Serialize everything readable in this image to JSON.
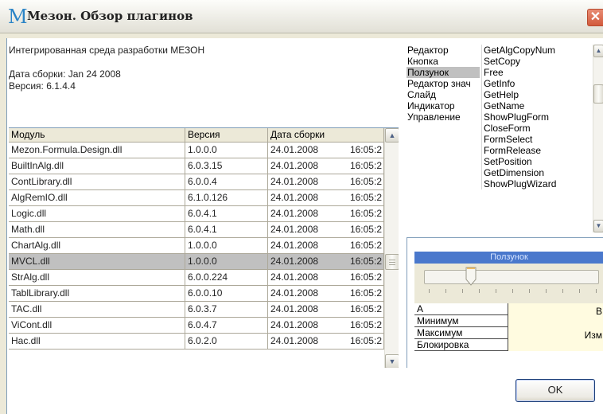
{
  "window": {
    "title": "Мезон. Обзор плагинов",
    "title_icon_glyph": "M",
    "close_label": "✕"
  },
  "info": {
    "env_name": "Интегрированная среда разработки МЕЗОН",
    "build_date": "Дата сборки: Jan 24 2008",
    "version": "Версия: 6.1.4.4"
  },
  "modules": {
    "headers": [
      "Модуль",
      "Версия",
      "Дата сборки"
    ],
    "rows": [
      {
        "name": "Mezon.Formula.Design.dll",
        "version": "1.0.0.0",
        "date": "24.01.2008",
        "time": "16:05:2"
      },
      {
        "name": "BuiltInAlg.dll",
        "version": "6.0.3.15",
        "date": "24.01.2008",
        "time": "16:05:2"
      },
      {
        "name": "ContLibrary.dll",
        "version": "6.0.0.4",
        "date": "24.01.2008",
        "time": "16:05:2"
      },
      {
        "name": "AlgRemIO.dll",
        "version": "6.1.0.126",
        "date": "24.01.2008",
        "time": "16:05:2"
      },
      {
        "name": "Logic.dll",
        "version": "6.0.4.1",
        "date": "24.01.2008",
        "time": "16:05:2"
      },
      {
        "name": "Math.dll",
        "version": "6.0.4.1",
        "date": "24.01.2008",
        "time": "16:05:2"
      },
      {
        "name": "ChartAlg.dll",
        "version": "1.0.0.0",
        "date": "24.01.2008",
        "time": "16:05:2"
      },
      {
        "name": "MVCL.dll",
        "version": "1.0.0.0",
        "date": "24.01.2008",
        "time": "16:05:2",
        "selected": true
      },
      {
        "name": "StrAlg.dll",
        "version": "6.0.0.224",
        "date": "24.01.2008",
        "time": "16:05:2"
      },
      {
        "name": "TablLibrary.dll",
        "version": "6.0.0.10",
        "date": "24.01.2008",
        "time": "16:05:2"
      },
      {
        "name": "TAC.dll",
        "version": "6.0.3.7",
        "date": "24.01.2008",
        "time": "16:05:2"
      },
      {
        "name": "ViCont.dll",
        "version": "6.0.4.7",
        "date": "24.01.2008",
        "time": "16:05:2"
      },
      {
        "name": "Нас.dll",
        "version": "6.0.2.0",
        "date": "24.01.2008",
        "time": "16:05:2"
      }
    ]
  },
  "categories": {
    "items": [
      "Редактор",
      "Кнопка",
      "Ползунок",
      "Редактор знач",
      "Слайд",
      "Индикатор",
      "Управление"
    ],
    "selected_index": 2
  },
  "methods": {
    "items": [
      "GetAlgCopyNum",
      "SetCopy",
      "Free",
      "GetInfo",
      "GetHelp",
      "GetName",
      "ShowPlugForm",
      "CloseForm",
      "FormSelect",
      "FormRelease",
      "SetPosition",
      "GetDimension",
      "ShowPlugWizard"
    ]
  },
  "preview": {
    "title": "Ползунок",
    "slider_fraction": 0.27,
    "properties": [
      {
        "name": "A",
        "value": "B"
      },
      {
        "name": "Минимум",
        "value": ""
      },
      {
        "name": "Максимум",
        "value": "Изм"
      },
      {
        "name": "Блокировка",
        "value": ""
      }
    ]
  },
  "buttons": {
    "ok": "OK"
  },
  "colors": {
    "selection": "#c0c0c0",
    "preview_title": "#4a78cc",
    "close": "#d25a3c"
  }
}
